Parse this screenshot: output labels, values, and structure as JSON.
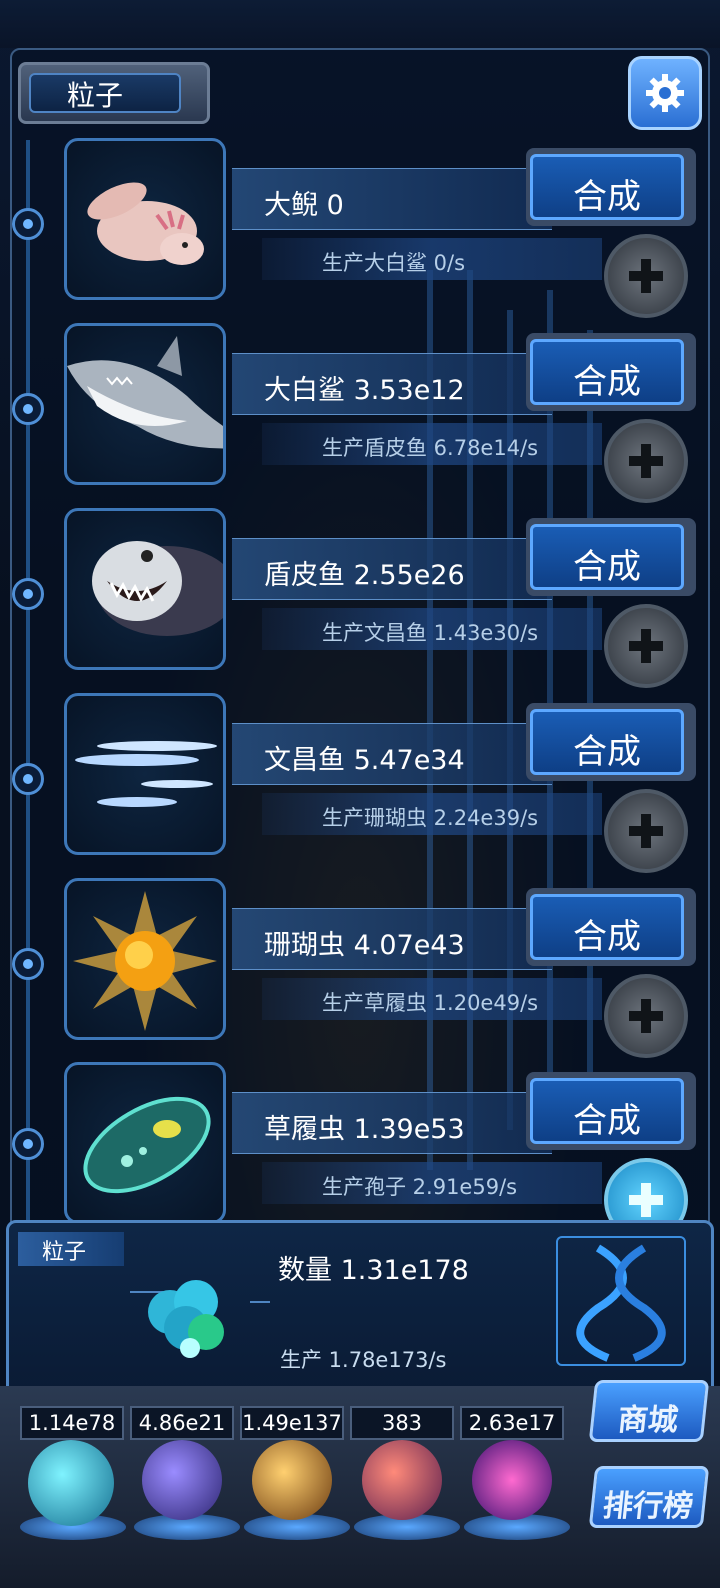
{
  "header": {
    "title": "粒子",
    "settings_icon": "gear-icon"
  },
  "creatures": [
    {
      "name_count": "大鲵 0",
      "production": "生产大白鲨 0/s",
      "combine_label": "合成",
      "image": "salamander"
    },
    {
      "name_count": "大白鲨 3.53e12",
      "production": "生产盾皮鱼 6.78e14/s",
      "combine_label": "合成",
      "image": "shark"
    },
    {
      "name_count": "盾皮鱼 2.55e26",
      "production": "生产文昌鱼 1.43e30/s",
      "combine_label": "合成",
      "image": "placoderm"
    },
    {
      "name_count": "文昌鱼 5.47e34",
      "production": "生产珊瑚虫 2.24e39/s",
      "combine_label": "合成",
      "image": "lancelet"
    },
    {
      "name_count": "珊瑚虫 4.07e43",
      "production": "生产草履虫 1.20e49/s",
      "combine_label": "合成",
      "image": "coral-polyp"
    },
    {
      "name_count": "草履虫 1.39e53",
      "production": "生产孢子 2.91e59/s",
      "combine_label": "合成",
      "image": "paramecium"
    }
  ],
  "particle_panel": {
    "tag": "粒子",
    "quantity": "数量 1.31e178",
    "production": "生产 1.78e173/s"
  },
  "resources": [
    {
      "value": "1.14e78",
      "orb": "atom-orb"
    },
    {
      "value": "4.86e21",
      "orb": "lightning-orb"
    },
    {
      "value": "1.49e137",
      "orb": "fire-orb"
    },
    {
      "value": "383",
      "orb": "brain-orb"
    },
    {
      "value": "2.63e17",
      "orb": "vortex-orb"
    }
  ],
  "side_buttons": {
    "shop": "商城",
    "ranking": "排行榜"
  },
  "colors": {
    "accent": "#2a6fd3",
    "combine_button": "#1a5db5",
    "plus_active": "#62d4ff"
  }
}
